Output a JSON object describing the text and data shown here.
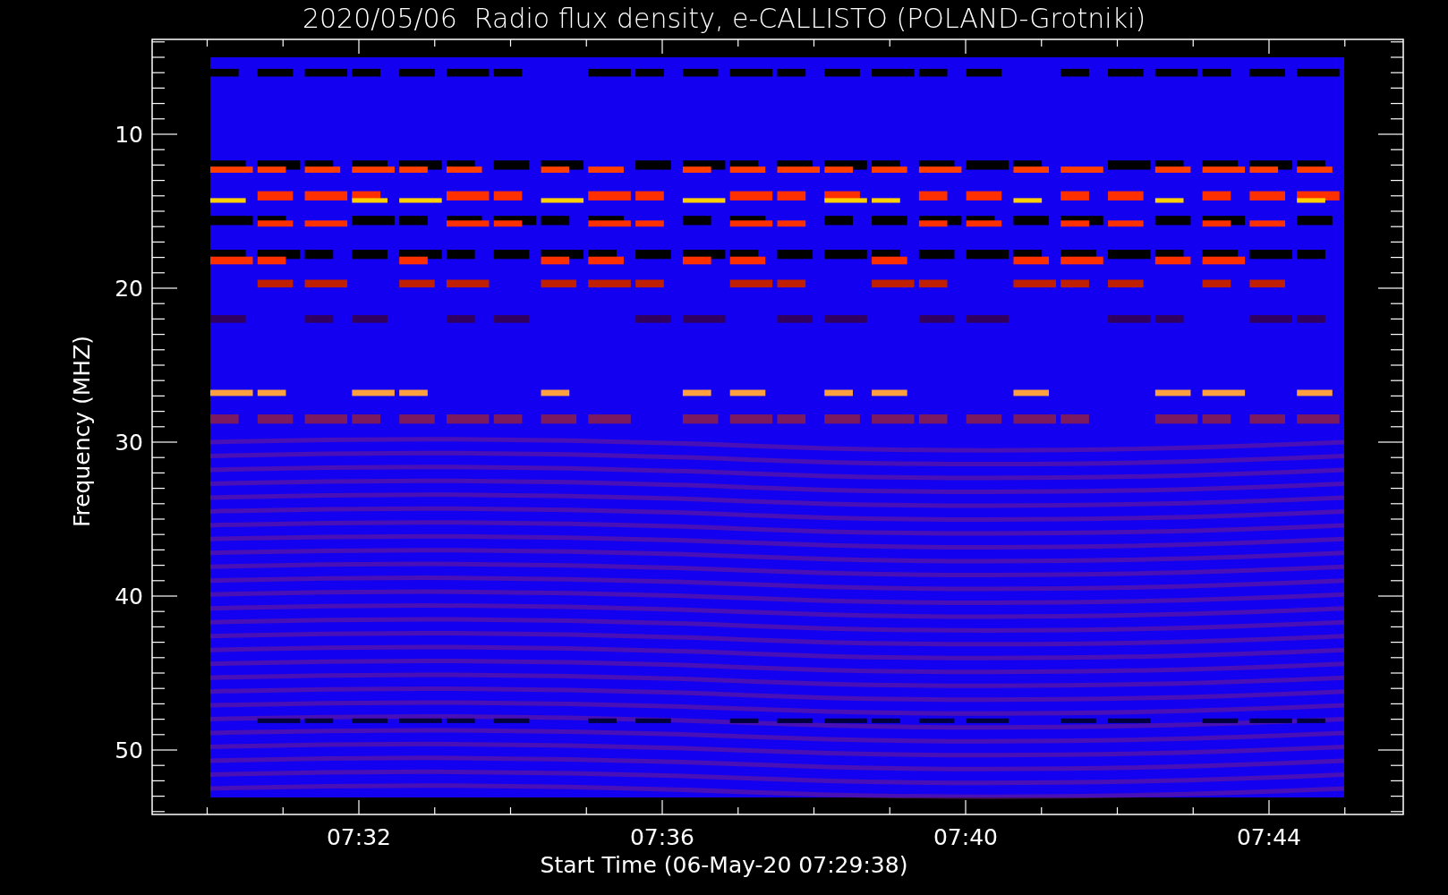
{
  "title": "2020/05/06  Radio flux density, e-CALLISTO (POLAND-Grotniki)",
  "y_axis": {
    "label": "Frequency (MHZ)",
    "ticks": [
      "10",
      "20",
      "30",
      "40",
      "50"
    ]
  },
  "x_axis": {
    "label": "Start Time (06-May-20 07:29:38)",
    "ticks": [
      "07:32",
      "07:36",
      "07:40",
      "07:44"
    ]
  }
}
